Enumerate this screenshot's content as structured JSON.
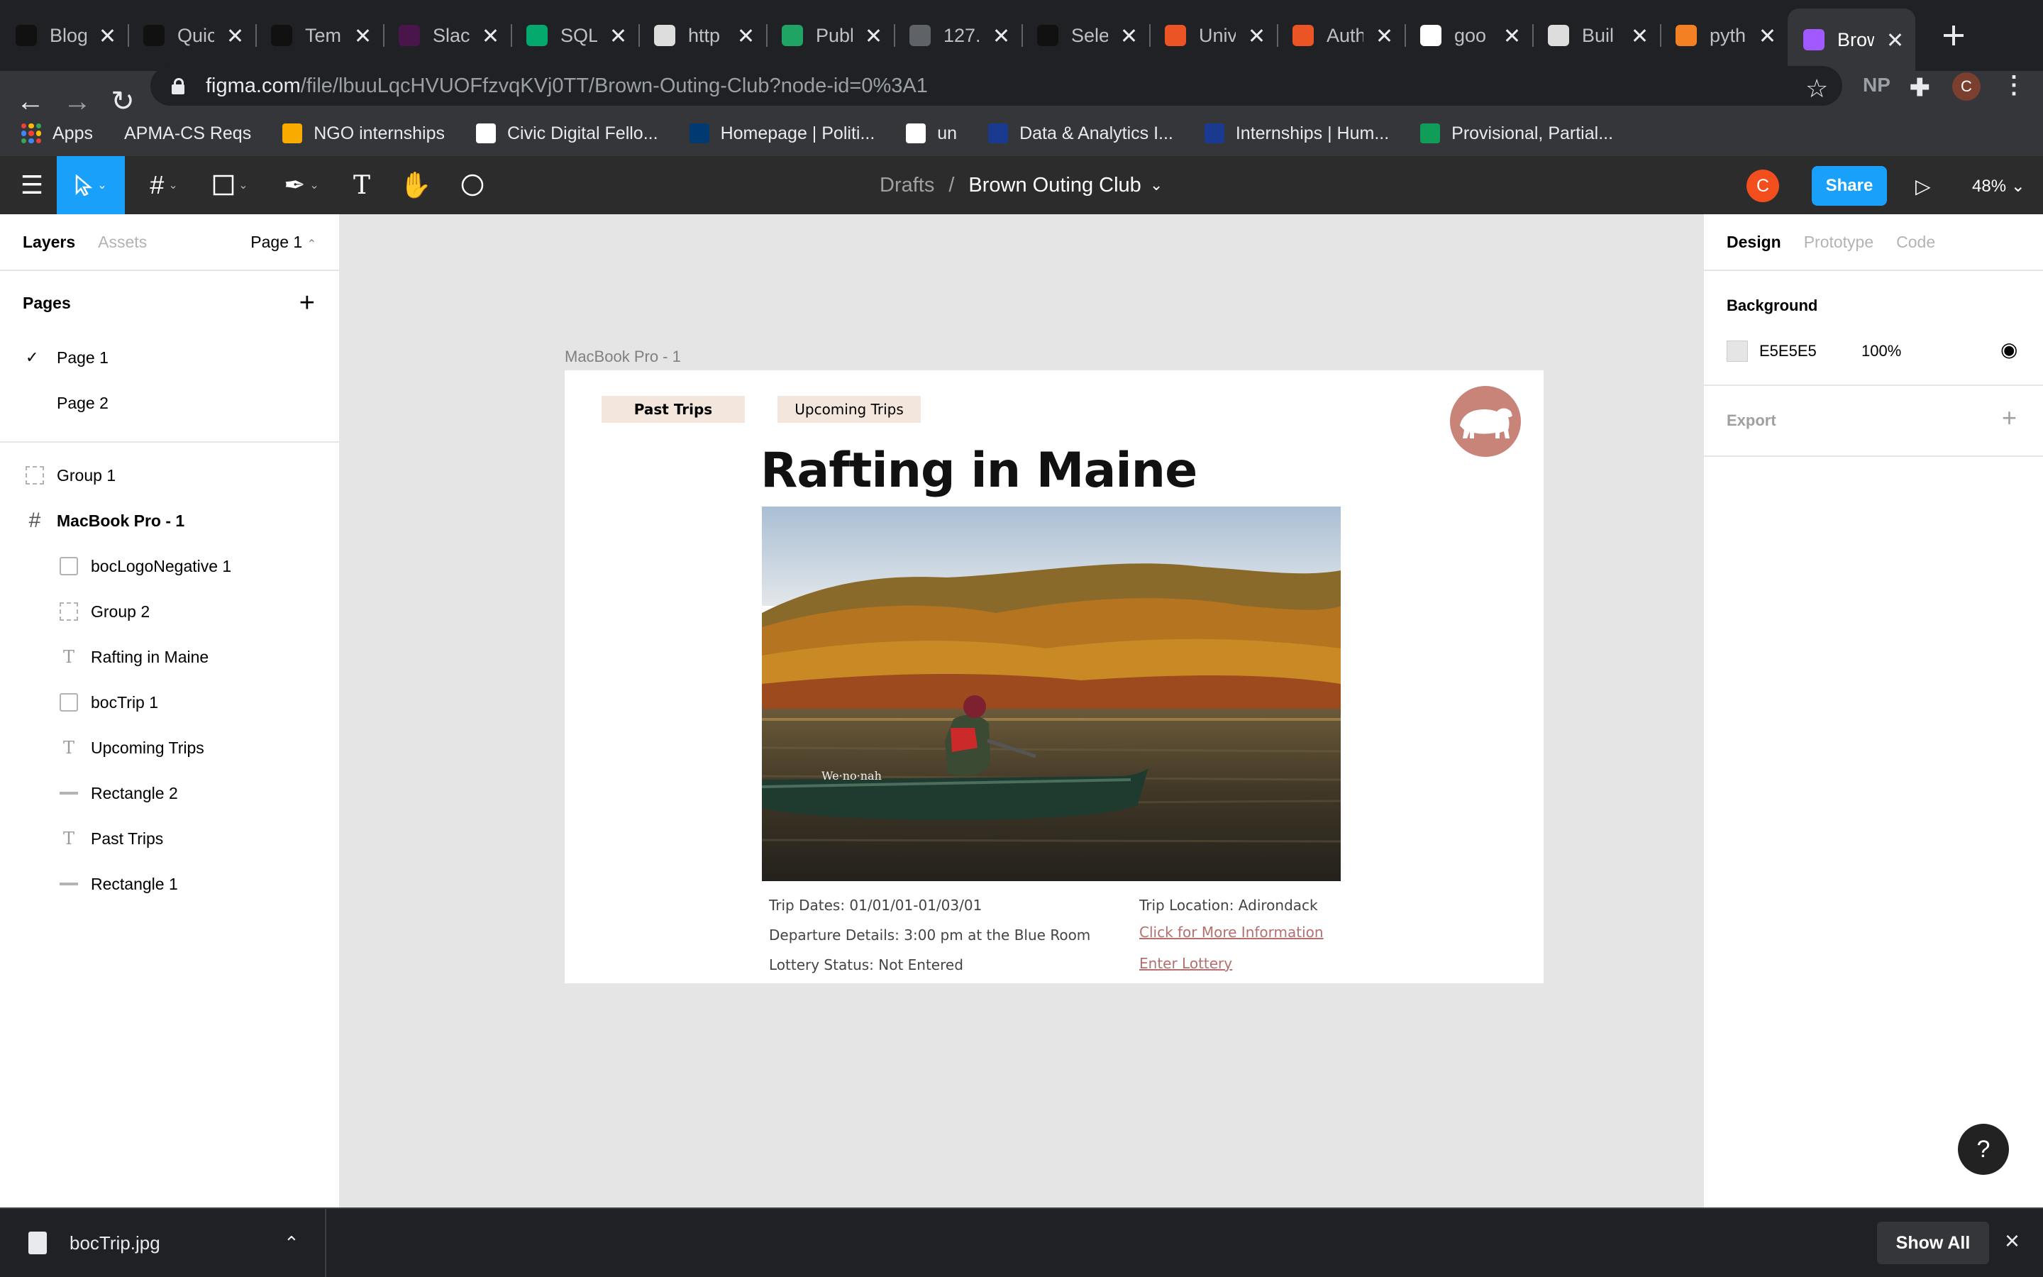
{
  "browser": {
    "tabs": [
      {
        "title": "Blog",
        "icon": "medium-icon",
        "color": "#111111"
      },
      {
        "title": "Quic",
        "icon": "medium-icon",
        "color": "#111111"
      },
      {
        "title": "Tem",
        "icon": "medium-icon",
        "color": "#111111"
      },
      {
        "title": "Slac",
        "icon": "slack-icon",
        "color": "#4a154b"
      },
      {
        "title": "SQL",
        "icon": "w3schools-icon",
        "color": "#04aa6d"
      },
      {
        "title": "http",
        "icon": "document-icon",
        "color": "#dddddd"
      },
      {
        "title": "Publ",
        "icon": "google-drive-icon",
        "color": "#1fa463"
      },
      {
        "title": "127.",
        "icon": "globe-icon",
        "color": "#5f6368"
      },
      {
        "title": "Sele",
        "icon": "medium-icon",
        "color": "#111111"
      },
      {
        "title": "Univ",
        "icon": "auth0-icon",
        "color": "#eb5424"
      },
      {
        "title": "Auth",
        "icon": "auth0-icon",
        "color": "#eb5424"
      },
      {
        "title": "goo",
        "icon": "github-icon",
        "color": "#ffffff"
      },
      {
        "title": "Buil",
        "icon": "ui-icon",
        "color": "#dddddd"
      },
      {
        "title": "pyth",
        "icon": "stackoverflow-icon",
        "color": "#f48024"
      },
      {
        "title": "Brow",
        "icon": "figma-icon",
        "color": "#a259ff"
      }
    ],
    "url_host": "figma.com",
    "url_path": "/file/lbuuLqcHVUOFfzvqKVj0TT/Brown-Outing-Club?node-id=0%3A1",
    "extension_label": "NP",
    "profile_initial": "C",
    "bookmarks": [
      {
        "label": "Apps",
        "color": "#ea4335"
      },
      {
        "label": "APMA-CS Reqs",
        "color": ""
      },
      {
        "label": "NGO internships",
        "color": "#f9ab00"
      },
      {
        "label": "Civic Digital Fello...",
        "color": "#ffffff"
      },
      {
        "label": "Homepage | Politi...",
        "color": "#003a70"
      },
      {
        "label": "un",
        "color": "#ffffff"
      },
      {
        "label": "Data & Analytics I...",
        "color": "#1a3a8f"
      },
      {
        "label": "Internships | Hum...",
        "color": "#1a3a8f"
      },
      {
        "label": "Provisional, Partial...",
        "color": "#0f9d58"
      }
    ]
  },
  "figma": {
    "breadcrumb_parent": "Drafts",
    "breadcrumb_sep": "/",
    "file_name": "Brown Outing Club",
    "user_initial": "C",
    "share_label": "Share",
    "zoom": "48%",
    "left_panel": {
      "tab_layers": "Layers",
      "tab_assets": "Assets",
      "page_selector": "Page 1",
      "pages_heading": "Pages",
      "pages": [
        "Page 1",
        "Page 2"
      ],
      "layers": [
        {
          "name": "Group 1",
          "type": "group",
          "indent": 0
        },
        {
          "name": "MacBook Pro - 1",
          "type": "frame",
          "indent": 0
        },
        {
          "name": "bocLogoNegative 1",
          "type": "image",
          "indent": 1
        },
        {
          "name": "Group 2",
          "type": "group",
          "indent": 1
        },
        {
          "name": "Rafting in Maine",
          "type": "text",
          "indent": 1
        },
        {
          "name": "bocTrip 1",
          "type": "image",
          "indent": 1
        },
        {
          "name": "Upcoming Trips",
          "type": "text",
          "indent": 1
        },
        {
          "name": "Rectangle 2",
          "type": "rect",
          "indent": 1
        },
        {
          "name": "Past Trips",
          "type": "text",
          "indent": 1
        },
        {
          "name": "Rectangle 1",
          "type": "rect",
          "indent": 1
        }
      ]
    },
    "canvas": {
      "frame_label": "MacBook Pro - 1",
      "past_trips": "Past Trips",
      "upcoming_trips": "Upcoming Trips",
      "title": "Rafting in Maine",
      "boat_text": "We·no·nah",
      "trip_dates": "Trip Dates: 01/01/01-01/03/01",
      "departure": "Departure Details: 3:00 pm at the Blue Room",
      "lottery_status": "Lottery Status: Not Entered",
      "location": "Trip Location: Adirondack",
      "more_info": "Click for More Information",
      "enter_lottery": "Enter Lottery"
    },
    "right_panel": {
      "tab_design": "Design",
      "tab_prototype": "Prototype",
      "tab_code": "Code",
      "background_heading": "Background",
      "background_hex": "E5E5E5",
      "background_opacity": "100%",
      "export_heading": "Export"
    },
    "help_label": "?"
  },
  "downloads": {
    "file_name": "bocTrip.jpg",
    "show_all": "Show All"
  }
}
